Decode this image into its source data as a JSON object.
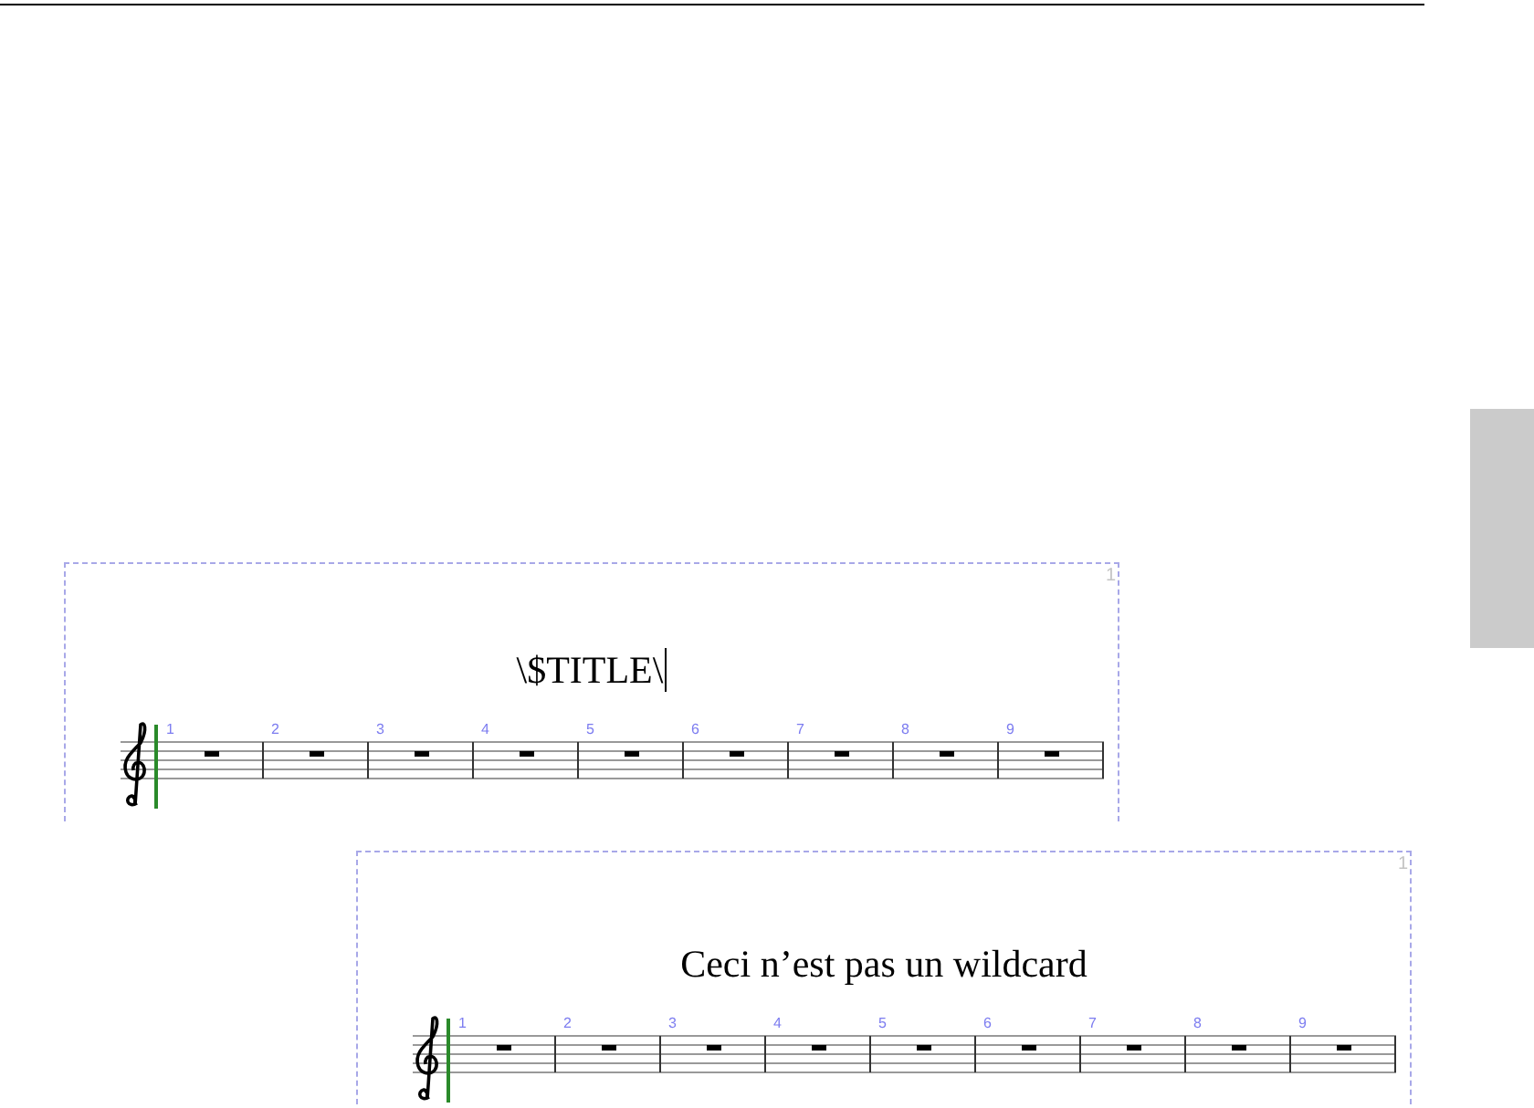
{
  "panels": [
    {
      "page_number": "1",
      "title": "\\$TITLE\\",
      "editing": true,
      "measures": [
        "1",
        "2",
        "3",
        "4",
        "5",
        "6",
        "7",
        "8",
        "9"
      ]
    },
    {
      "page_number": "1",
      "title": "Ceci n’est pas un wildcard",
      "editing": false,
      "measures": [
        "1",
        "2",
        "3",
        "4",
        "5",
        "6",
        "7",
        "8",
        "9"
      ]
    }
  ]
}
